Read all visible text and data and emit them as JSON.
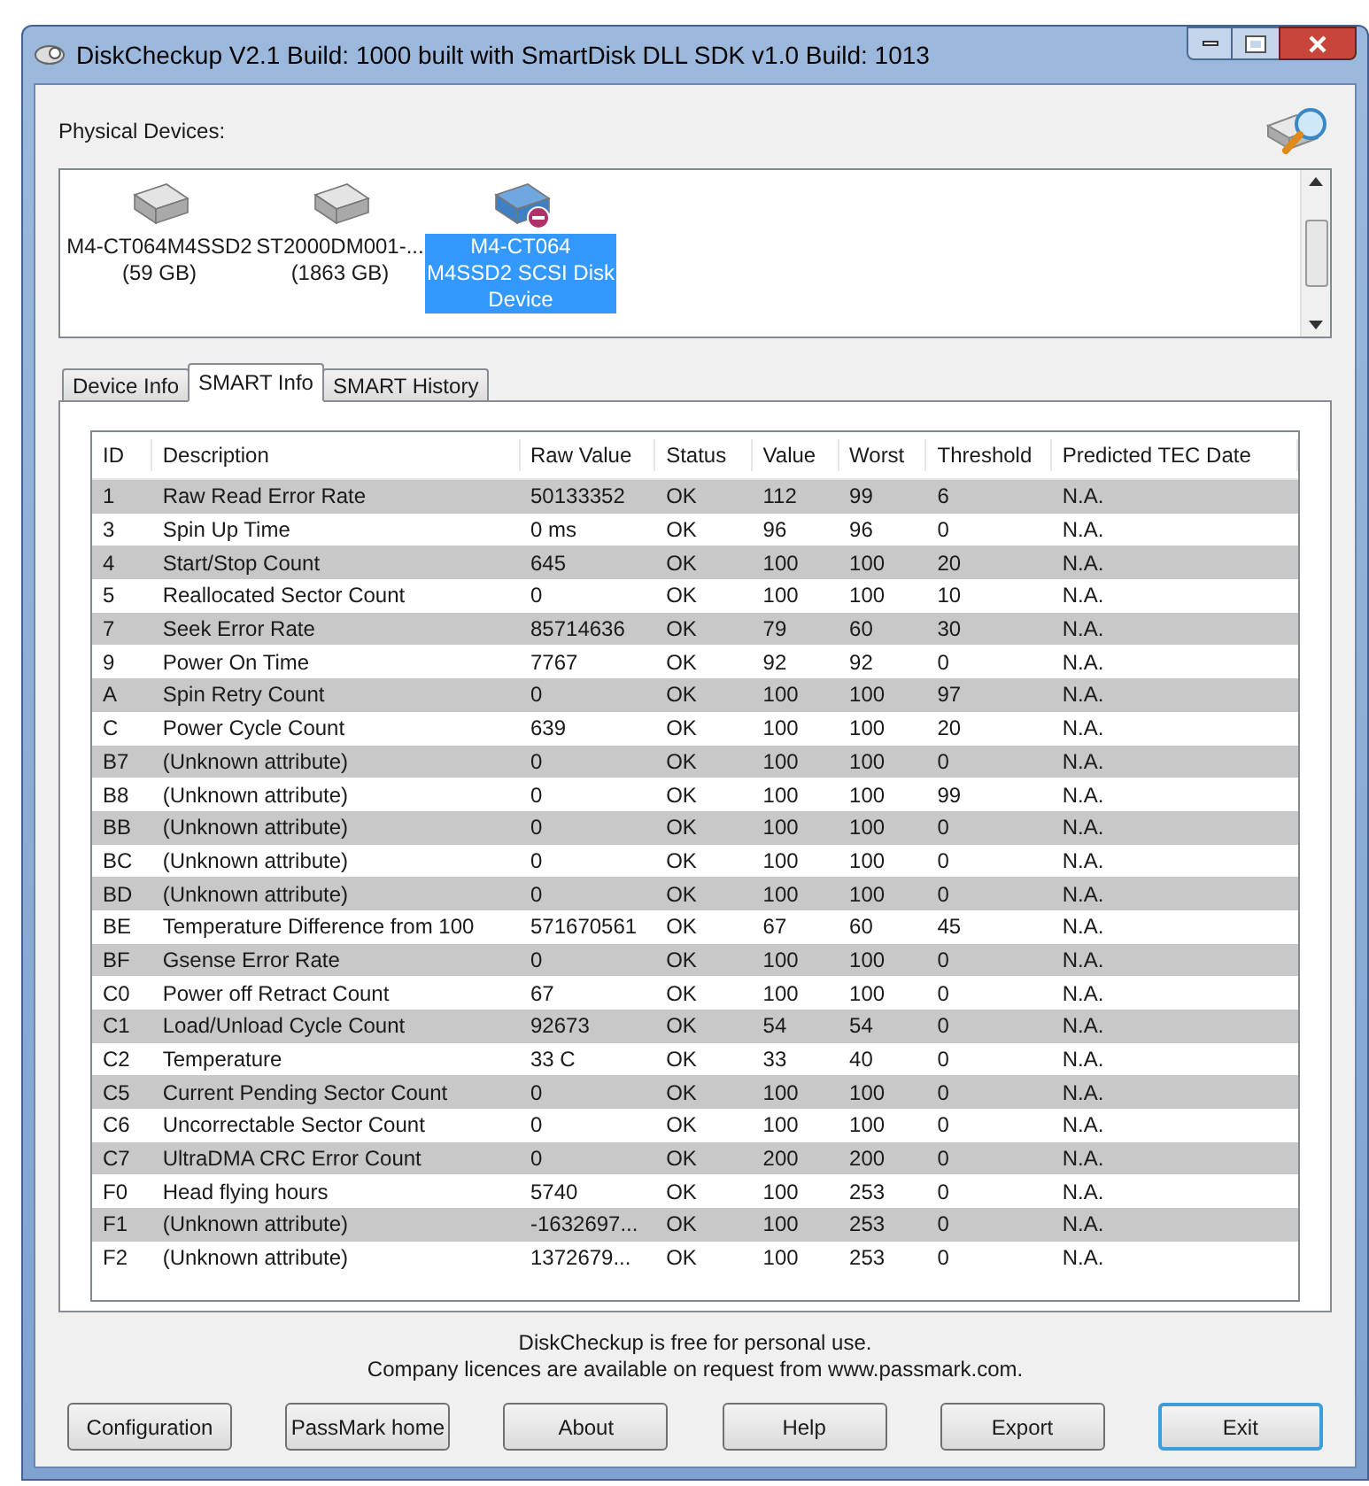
{
  "window": {
    "title": "DiskCheckup V2.1 Build: 1000 built with SmartDisk DLL SDK v1.0 Build: 1013"
  },
  "devices_label": "Physical Devices:",
  "devices": [
    {
      "lines": [
        "M4-CT064M4SSD2",
        "(59 GB)"
      ],
      "selected": false
    },
    {
      "lines": [
        "ST2000DM001-...",
        "(1863 GB)"
      ],
      "selected": false
    },
    {
      "lines": [
        "M4-CT064",
        "M4SSD2 SCSI Disk",
        "Device"
      ],
      "selected": true
    }
  ],
  "tabs": [
    {
      "label": "Device Info",
      "selected": false
    },
    {
      "label": "SMART Info",
      "selected": true
    },
    {
      "label": "SMART History",
      "selected": false
    }
  ],
  "table": {
    "columns": [
      "ID",
      "Description",
      "Raw Value",
      "Status",
      "Value",
      "Worst",
      "Threshold",
      "Predicted TEC Date"
    ],
    "rows": [
      [
        "1",
        "Raw Read Error Rate",
        "50133352",
        "OK",
        "112",
        "99",
        "6",
        "N.A."
      ],
      [
        "3",
        "Spin Up Time",
        "0 ms",
        "OK",
        "96",
        "96",
        "0",
        "N.A."
      ],
      [
        "4",
        "Start/Stop Count",
        "645",
        "OK",
        "100",
        "100",
        "20",
        "N.A."
      ],
      [
        "5",
        "Reallocated Sector Count",
        "0",
        "OK",
        "100",
        "100",
        "10",
        "N.A."
      ],
      [
        "7",
        "Seek Error Rate",
        "85714636",
        "OK",
        "79",
        "60",
        "30",
        "N.A."
      ],
      [
        "9",
        "Power On Time",
        "7767",
        "OK",
        "92",
        "92",
        "0",
        "N.A."
      ],
      [
        "A",
        "Spin Retry Count",
        "0",
        "OK",
        "100",
        "100",
        "97",
        "N.A."
      ],
      [
        "C",
        "Power Cycle Count",
        "639",
        "OK",
        "100",
        "100",
        "20",
        "N.A."
      ],
      [
        "B7",
        "(Unknown attribute)",
        "0",
        "OK",
        "100",
        "100",
        "0",
        "N.A."
      ],
      [
        "B8",
        "(Unknown attribute)",
        "0",
        "OK",
        "100",
        "100",
        "99",
        "N.A."
      ],
      [
        "BB",
        "(Unknown attribute)",
        "0",
        "OK",
        "100",
        "100",
        "0",
        "N.A."
      ],
      [
        "BC",
        "(Unknown attribute)",
        "0",
        "OK",
        "100",
        "100",
        "0",
        "N.A."
      ],
      [
        "BD",
        "(Unknown attribute)",
        "0",
        "OK",
        "100",
        "100",
        "0",
        "N.A."
      ],
      [
        "BE",
        "Temperature Difference from 100",
        "571670561",
        "OK",
        "67",
        "60",
        "45",
        "N.A."
      ],
      [
        "BF",
        "Gsense Error Rate",
        "0",
        "OK",
        "100",
        "100",
        "0",
        "N.A."
      ],
      [
        "C0",
        "Power off Retract Count",
        "67",
        "OK",
        "100",
        "100",
        "0",
        "N.A."
      ],
      [
        "C1",
        "Load/Unload Cycle Count",
        "92673",
        "OK",
        "54",
        "54",
        "0",
        "N.A."
      ],
      [
        "C2",
        "Temperature",
        "33 C",
        "OK",
        "33",
        "40",
        "0",
        "N.A."
      ],
      [
        "C5",
        "Current Pending Sector Count",
        "0",
        "OK",
        "100",
        "100",
        "0",
        "N.A."
      ],
      [
        "C6",
        "Uncorrectable Sector Count",
        "0",
        "OK",
        "100",
        "100",
        "0",
        "N.A."
      ],
      [
        "C7",
        "UltraDMA CRC Error Count",
        "0",
        "OK",
        "200",
        "200",
        "0",
        "N.A."
      ],
      [
        "F0",
        "Head flying hours",
        "5740",
        "OK",
        "100",
        "253",
        "0",
        "N.A."
      ],
      [
        "F1",
        "(Unknown attribute)",
        "-1632697...",
        "OK",
        "100",
        "253",
        "0",
        "N.A."
      ],
      [
        "F2",
        "(Unknown attribute)",
        "1372679...",
        "OK",
        "100",
        "253",
        "0",
        "N.A."
      ]
    ]
  },
  "footer": [
    "DiskCheckup is free for personal use.",
    "Company licences are available on request from www.passmark.com."
  ],
  "buttons": [
    {
      "label": "Configuration",
      "selected": false
    },
    {
      "label": "PassMark home",
      "selected": false
    },
    {
      "label": "About",
      "selected": false
    },
    {
      "label": "Help",
      "selected": false
    },
    {
      "label": "Export",
      "selected": false
    },
    {
      "label": "Exit",
      "selected": true
    }
  ]
}
